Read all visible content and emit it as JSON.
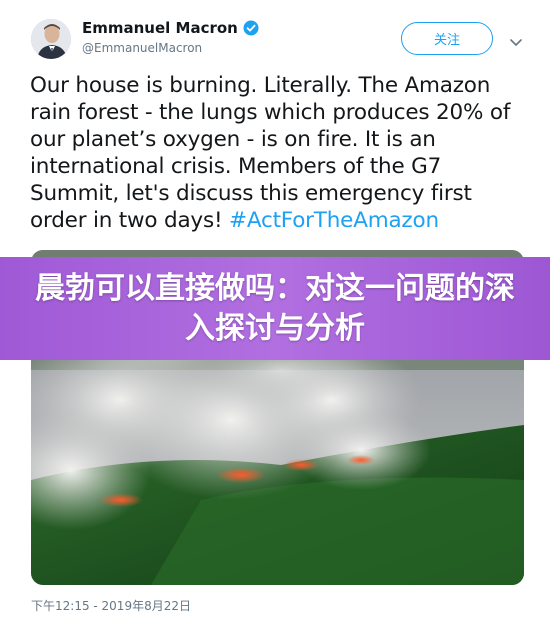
{
  "author": {
    "name": "Emmanuel Macron",
    "handle": "@EmmanuelMacron",
    "verified": true
  },
  "follow_label": "关注",
  "tweet": {
    "lines": [
      "Our house is burning. Literally. The Amazon",
      "rain forest - the lungs which produces 20% of",
      "our planet’s oxygen - is on fire. It is an",
      "international crisis. Members of the G7",
      "Summit, let's discuss this emergency first",
      "order in two days! "
    ],
    "hashtag": "#ActForTheAmazon"
  },
  "overlay_title": "晨勃可以直接做吗：对这一问题的深入探讨与分析",
  "timestamp": "下午12:15 - 2019年8月22日",
  "colors": {
    "accent": "#1da1f2",
    "banner": "#a862dc",
    "muted": "#657786"
  },
  "icons": {
    "verified": "verified-badge-icon",
    "caret": "chevron-down-icon"
  }
}
